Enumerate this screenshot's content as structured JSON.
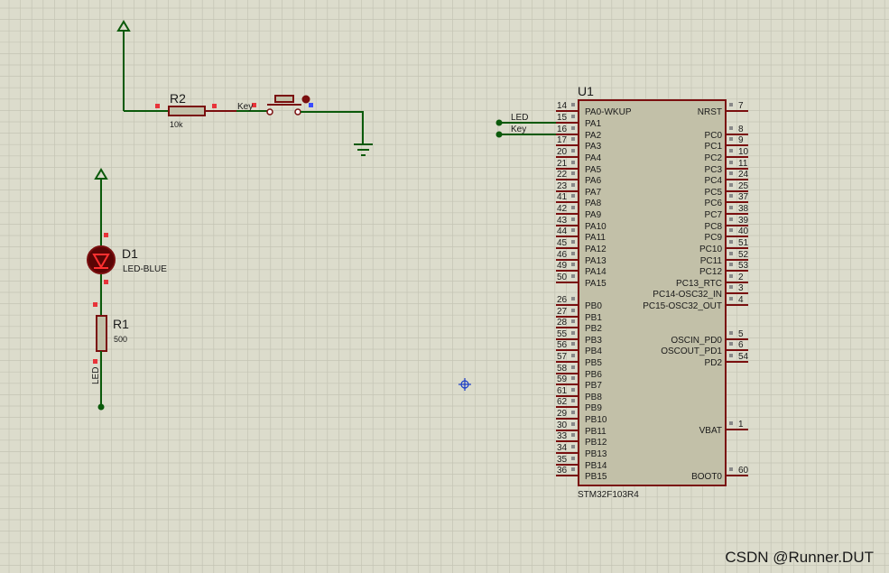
{
  "colors": {
    "background": "#dcdccc",
    "grid_minor": "#c4c4b4",
    "grid_major": "#b4b4a4",
    "wire": "#0b5a0b",
    "component": "#7a0f0f",
    "chip_fill": "#c2c0a8",
    "pin_marker": "#e8333a",
    "pin_square": "#888888",
    "text": "#1a1a1a",
    "cursor": "#1a3cc8",
    "watermark": "#ffffff"
  },
  "resistor_r2": {
    "ref": "R2",
    "value": "10k"
  },
  "key_switch": {
    "label": "Key"
  },
  "led_d1": {
    "ref": "D1",
    "value": "LED-BLUE"
  },
  "resistor_r1": {
    "ref": "R1",
    "value": "500",
    "net_label": "LED"
  },
  "net_labels": {
    "led": "LED",
    "key": "Key"
  },
  "chip": {
    "ref": "U1",
    "part": "STM32F103R4",
    "left_pins": [
      {
        "num": "14",
        "name": "PA0-WKUP"
      },
      {
        "num": "15",
        "name": "PA1"
      },
      {
        "num": "16",
        "name": "PA2"
      },
      {
        "num": "17",
        "name": "PA3"
      },
      {
        "num": "20",
        "name": "PA4"
      },
      {
        "num": "21",
        "name": "PA5"
      },
      {
        "num": "22",
        "name": "PA6"
      },
      {
        "num": "23",
        "name": "PA7"
      },
      {
        "num": "41",
        "name": "PA8"
      },
      {
        "num": "42",
        "name": "PA9"
      },
      {
        "num": "43",
        "name": "PA10"
      },
      {
        "num": "44",
        "name": "PA11"
      },
      {
        "num": "45",
        "name": "PA12"
      },
      {
        "num": "46",
        "name": "PA13"
      },
      {
        "num": "49",
        "name": "PA14"
      },
      {
        "num": "50",
        "name": "PA15"
      },
      {
        "num": "26",
        "name": "PB0"
      },
      {
        "num": "27",
        "name": "PB1"
      },
      {
        "num": "28",
        "name": "PB2"
      },
      {
        "num": "55",
        "name": "PB3"
      },
      {
        "num": "56",
        "name": "PB4"
      },
      {
        "num": "57",
        "name": "PB5"
      },
      {
        "num": "58",
        "name": "PB6"
      },
      {
        "num": "59",
        "name": "PB7"
      },
      {
        "num": "61",
        "name": "PB8"
      },
      {
        "num": "62",
        "name": "PB9"
      },
      {
        "num": "29",
        "name": "PB10"
      },
      {
        "num": "30",
        "name": "PB11"
      },
      {
        "num": "33",
        "name": "PB12"
      },
      {
        "num": "34",
        "name": "PB13"
      },
      {
        "num": "35",
        "name": "PB14"
      },
      {
        "num": "36",
        "name": "PB15"
      }
    ],
    "right_pins": [
      {
        "num": "7",
        "name": "NRST"
      },
      {
        "num": "8",
        "name": "PC0"
      },
      {
        "num": "9",
        "name": "PC1"
      },
      {
        "num": "10",
        "name": "PC2"
      },
      {
        "num": "11",
        "name": "PC3"
      },
      {
        "num": "24",
        "name": "PC4"
      },
      {
        "num": "25",
        "name": "PC5"
      },
      {
        "num": "37",
        "name": "PC6"
      },
      {
        "num": "38",
        "name": "PC7"
      },
      {
        "num": "39",
        "name": "PC8"
      },
      {
        "num": "40",
        "name": "PC9"
      },
      {
        "num": "51",
        "name": "PC10"
      },
      {
        "num": "52",
        "name": "PC11"
      },
      {
        "num": "53",
        "name": "PC12"
      },
      {
        "num": "2",
        "name": "PC13_RTC"
      },
      {
        "num": "3",
        "name": "PC14-OSC32_IN"
      },
      {
        "num": "4",
        "name": "PC15-OSC32_OUT"
      },
      {
        "num": "5",
        "name": "OSCIN_PD0"
      },
      {
        "num": "6",
        "name": "OSCOUT_PD1"
      },
      {
        "num": "54",
        "name": "PD2"
      },
      {
        "num": "1",
        "name": "VBAT"
      },
      {
        "num": "60",
        "name": "BOOT0"
      }
    ]
  },
  "watermark": "CSDN @Runner.DUT"
}
